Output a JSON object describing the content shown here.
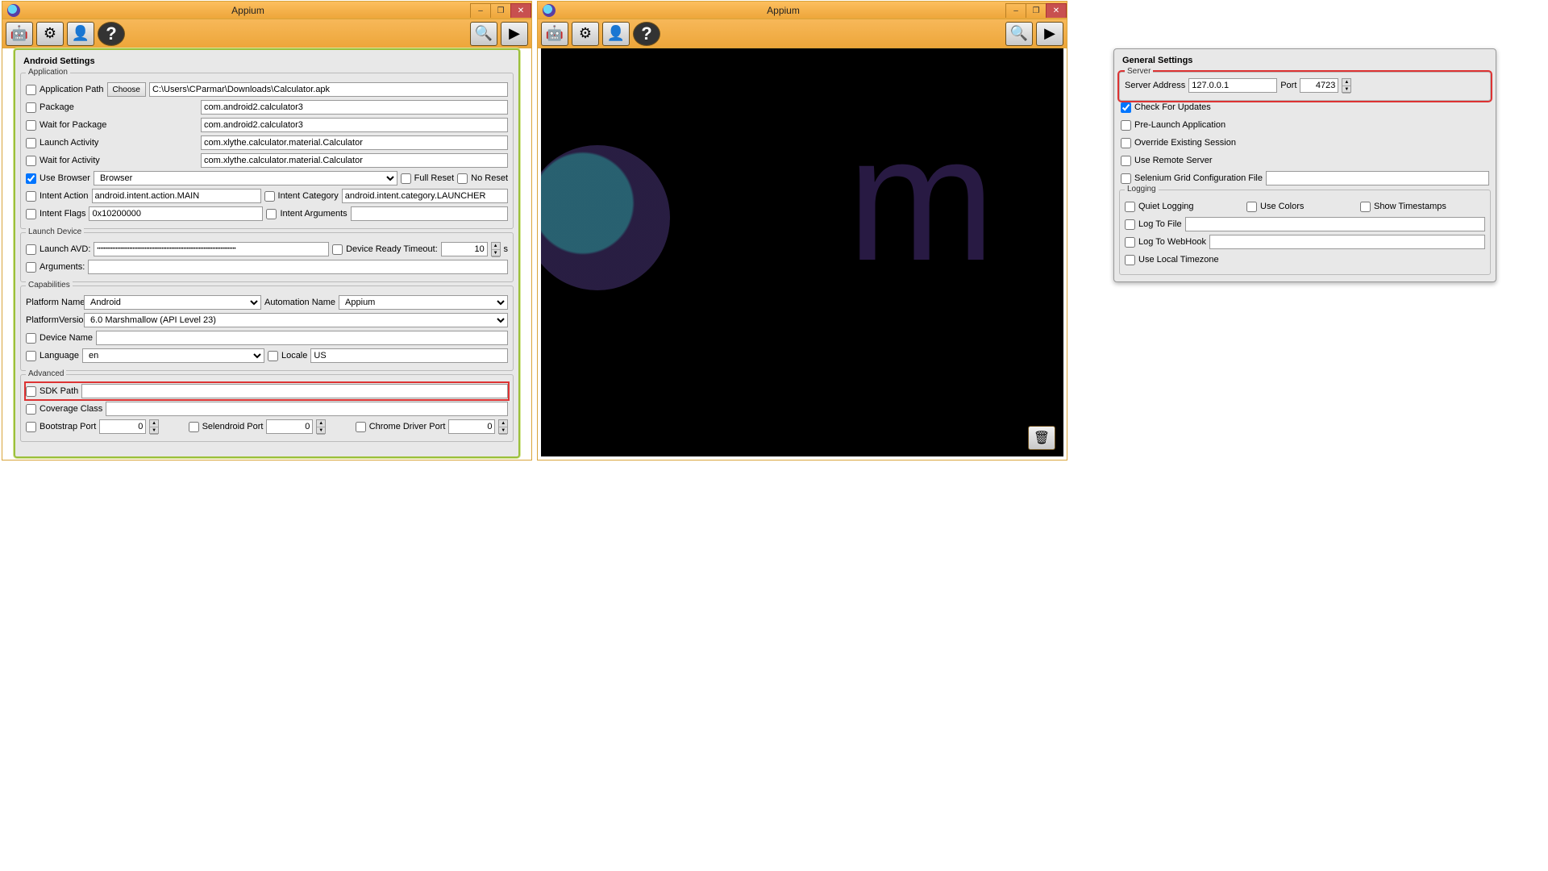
{
  "win": {
    "title": "Appium",
    "min": "–",
    "max": "❐",
    "close": "✕"
  },
  "toolbar": {
    "android": "🤖",
    "gear": "⚙",
    "user": "👤",
    "help": "?",
    "search": "🔍",
    "play": "▶"
  },
  "android": {
    "panel_title": "Android Settings",
    "application": {
      "title": "Application",
      "app_path_label": "Application Path",
      "choose": "Choose",
      "app_path": "C:\\Users\\CParmar\\Downloads\\Calculator.apk",
      "package_label": "Package",
      "package": "com.android2.calculator3",
      "wait_package_label": "Wait for Package",
      "wait_package": "com.android2.calculator3",
      "launch_activity_label": "Launch Activity",
      "launch_activity": "com.xlythe.calculator.material.Calculator",
      "wait_activity_label": "Wait for Activity",
      "wait_activity": "com.xlythe.calculator.material.Calculator",
      "use_browser_label": "Use Browser",
      "browser": "Browser",
      "full_reset": "Full Reset",
      "no_reset": "No Reset",
      "intent_action_label": "Intent Action",
      "intent_action": "android.intent.action.MAIN",
      "intent_category_label": "Intent Category",
      "intent_category": "android.intent.category.LAUNCHER",
      "intent_flags_label": "Intent Flags",
      "intent_flags": "0x10200000",
      "intent_args_label": "Intent Arguments"
    },
    "launch": {
      "title": "Launch Device",
      "launch_avd_label": "Launch AVD:",
      "avd": "••••••••••••••••••••••••••••••••••••••••••••••••••••••••••••••••••••••••••••••••••",
      "ready_label": "Device Ready Timeout:",
      "ready": "10",
      "s": "s",
      "args_label": "Arguments:"
    },
    "caps": {
      "title": "Capabilities",
      "platform_name_label": "Platform Name",
      "platform_name": "Android",
      "automation_name_label": "Automation Name",
      "automation_name": "Appium",
      "platform_version_label": "PlatformVersion",
      "platform_version": "6.0 Marshmallow (API Level 23)",
      "device_name_label": "Device Name",
      "language_label": "Language",
      "language": "en",
      "locale_label": "Locale",
      "locale": "US"
    },
    "adv": {
      "title": "Advanced",
      "sdk_label": "SDK Path",
      "coverage_label": "Coverage Class",
      "bootstrap_label": "Bootstrap Port",
      "bootstrap": "0",
      "selendroid_label": "Selendroid Port",
      "selendroid": "0",
      "chrome_label": "Chrome Driver Port",
      "chrome": "0"
    }
  },
  "general": {
    "panel_title": "General Settings",
    "server": {
      "title": "Server",
      "addr_label": "Server Address",
      "addr": "127.0.0.1",
      "port_label": "Port",
      "port": "4723",
      "check_updates": "Check For Updates",
      "pre_launch": "Pre-Launch Application",
      "override": "Override Existing Session",
      "remote": "Use Remote Server",
      "selenium_grid": "Selenium Grid Configuration File"
    },
    "logging": {
      "title": "Logging",
      "quiet": "Quiet Logging",
      "colors": "Use Colors",
      "timestamps": "Show Timestamps",
      "to_file": "Log To File",
      "to_webhook": "Log To WebHook",
      "local_tz": "Use Local Timezone"
    }
  },
  "trash": "🗑"
}
